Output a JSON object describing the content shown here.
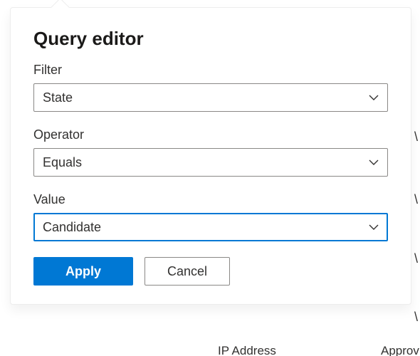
{
  "panel": {
    "title": "Query editor",
    "filter": {
      "label": "Filter",
      "value": "State"
    },
    "operator": {
      "label": "Operator",
      "value": "Equals"
    },
    "value": {
      "label": "Value",
      "value": "Candidate"
    },
    "apply_label": "Apply",
    "cancel_label": "Cancel"
  },
  "background": {
    "bottom_text": "IP Address",
    "right_text": "Approv"
  }
}
